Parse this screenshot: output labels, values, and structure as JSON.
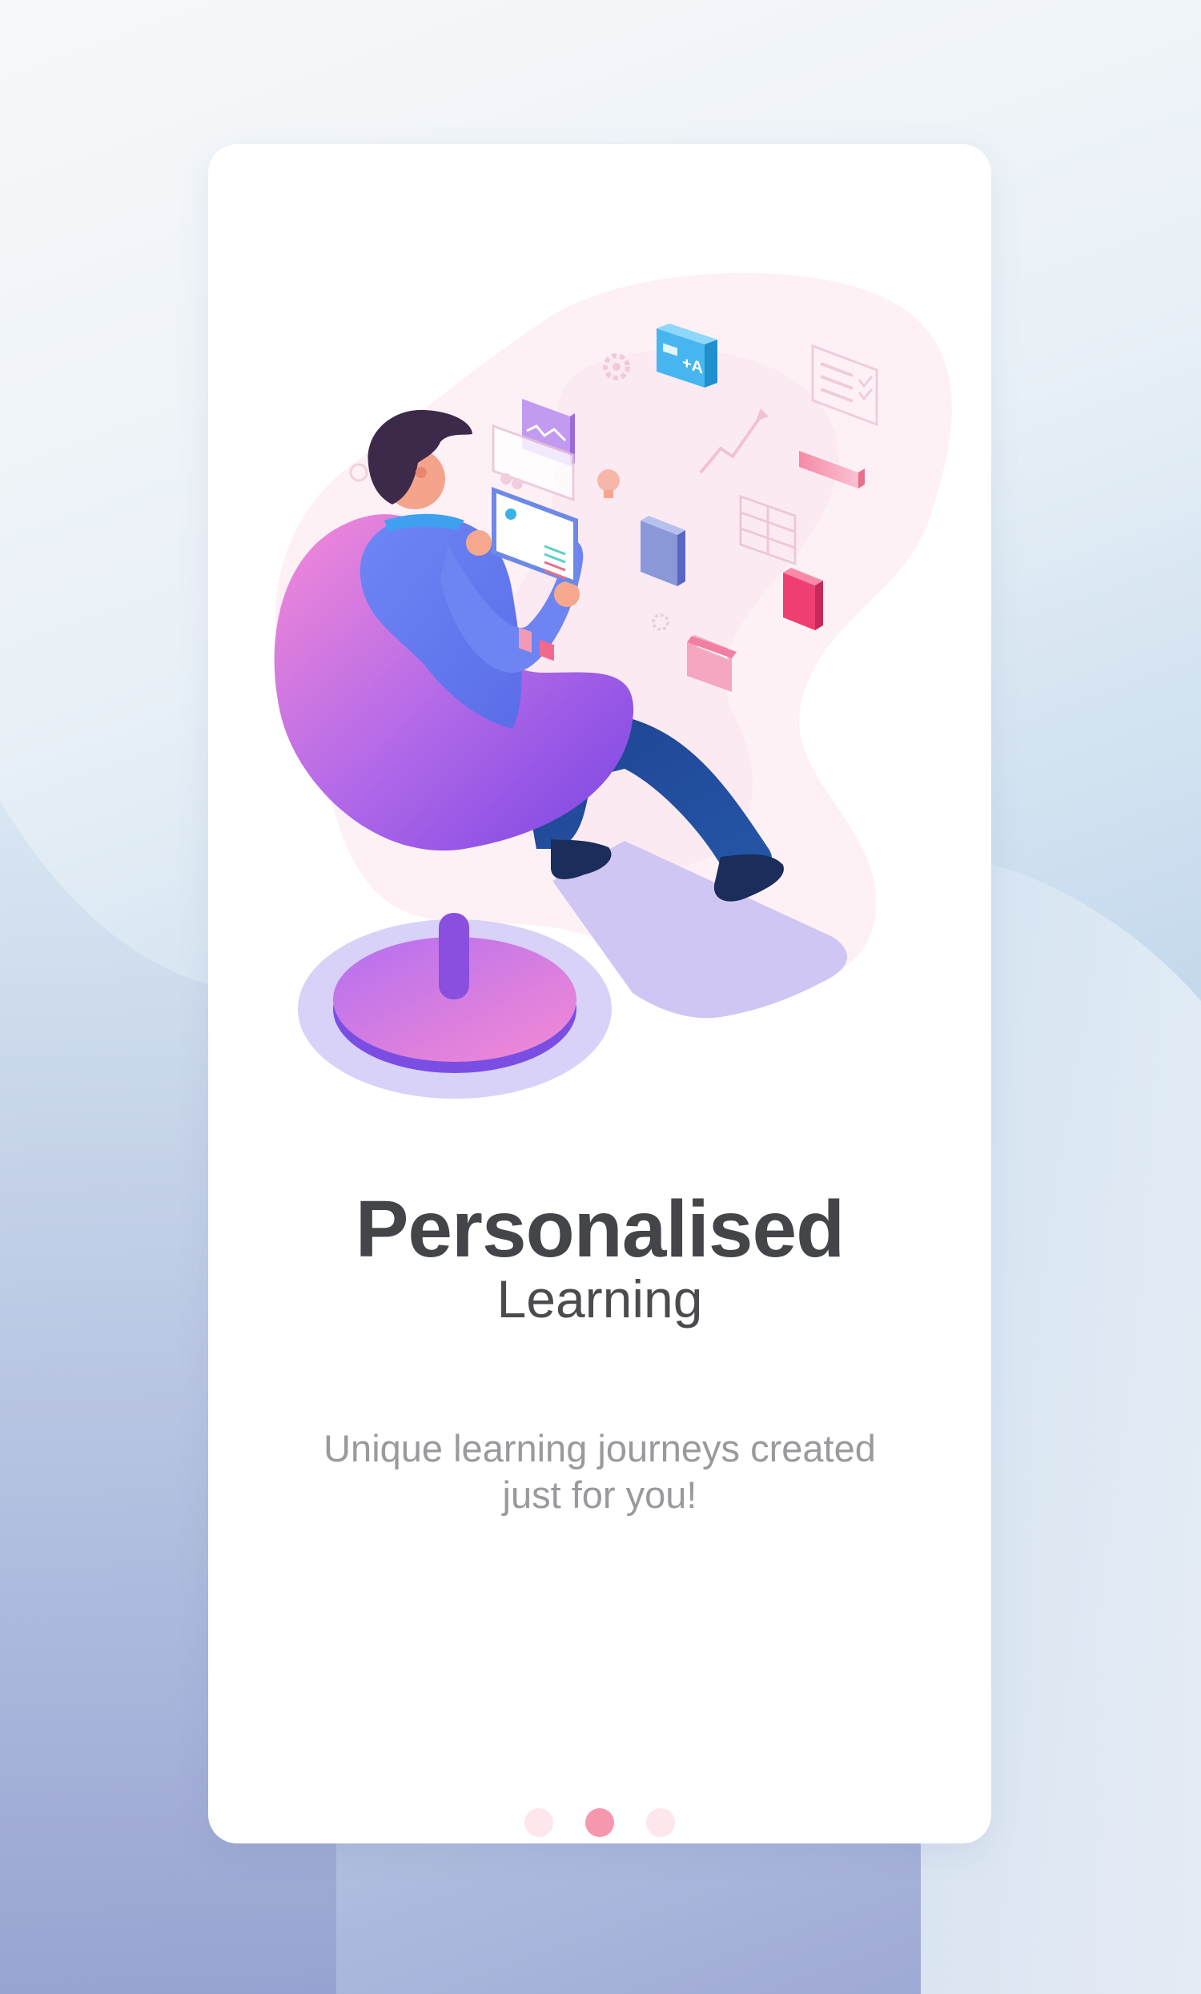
{
  "onboarding": {
    "title": "Personalised",
    "subtitle": "Learning",
    "description": "Unique learning journeys created just for you!",
    "illustration_icon": "person-in-chair-with-tablet-illustration",
    "pagination": {
      "total": 3,
      "active": 2
    }
  },
  "colors": {
    "title": "#444549",
    "description": "#9a9a9e",
    "dot_active": "#f797ad",
    "dot_inactive": "#fde6ec",
    "chair": "#a95ee6",
    "shirt": "#5f7df2",
    "pants": "#1e4f99"
  }
}
